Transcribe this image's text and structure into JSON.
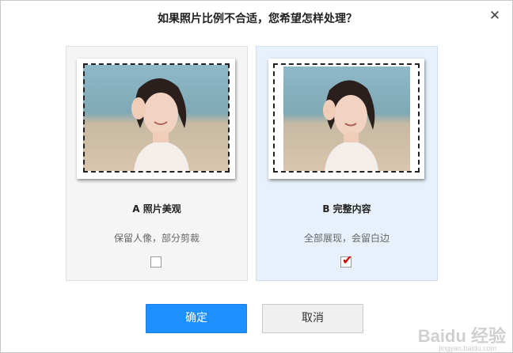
{
  "dialog": {
    "title": "如果照片比例不合适，您希望怎样处理？",
    "close_glyph": "✕"
  },
  "options": [
    {
      "label": "A 照片美观",
      "description": "保留人像，部分剪裁",
      "checked": false
    },
    {
      "label": "B 完整内容",
      "description": "全部展现，会留白边",
      "checked": true,
      "check_glyph": "✔"
    }
  ],
  "buttons": {
    "confirm": "确定",
    "cancel": "取消"
  },
  "colors": {
    "primary": "#1e8fff",
    "selected_card": "#e8f1fb",
    "unselected_card": "#f5f5f5",
    "checkmark": "#d40000"
  },
  "watermark": {
    "main": "Baidu 经验",
    "sub": "jingyan.baidu.com"
  }
}
